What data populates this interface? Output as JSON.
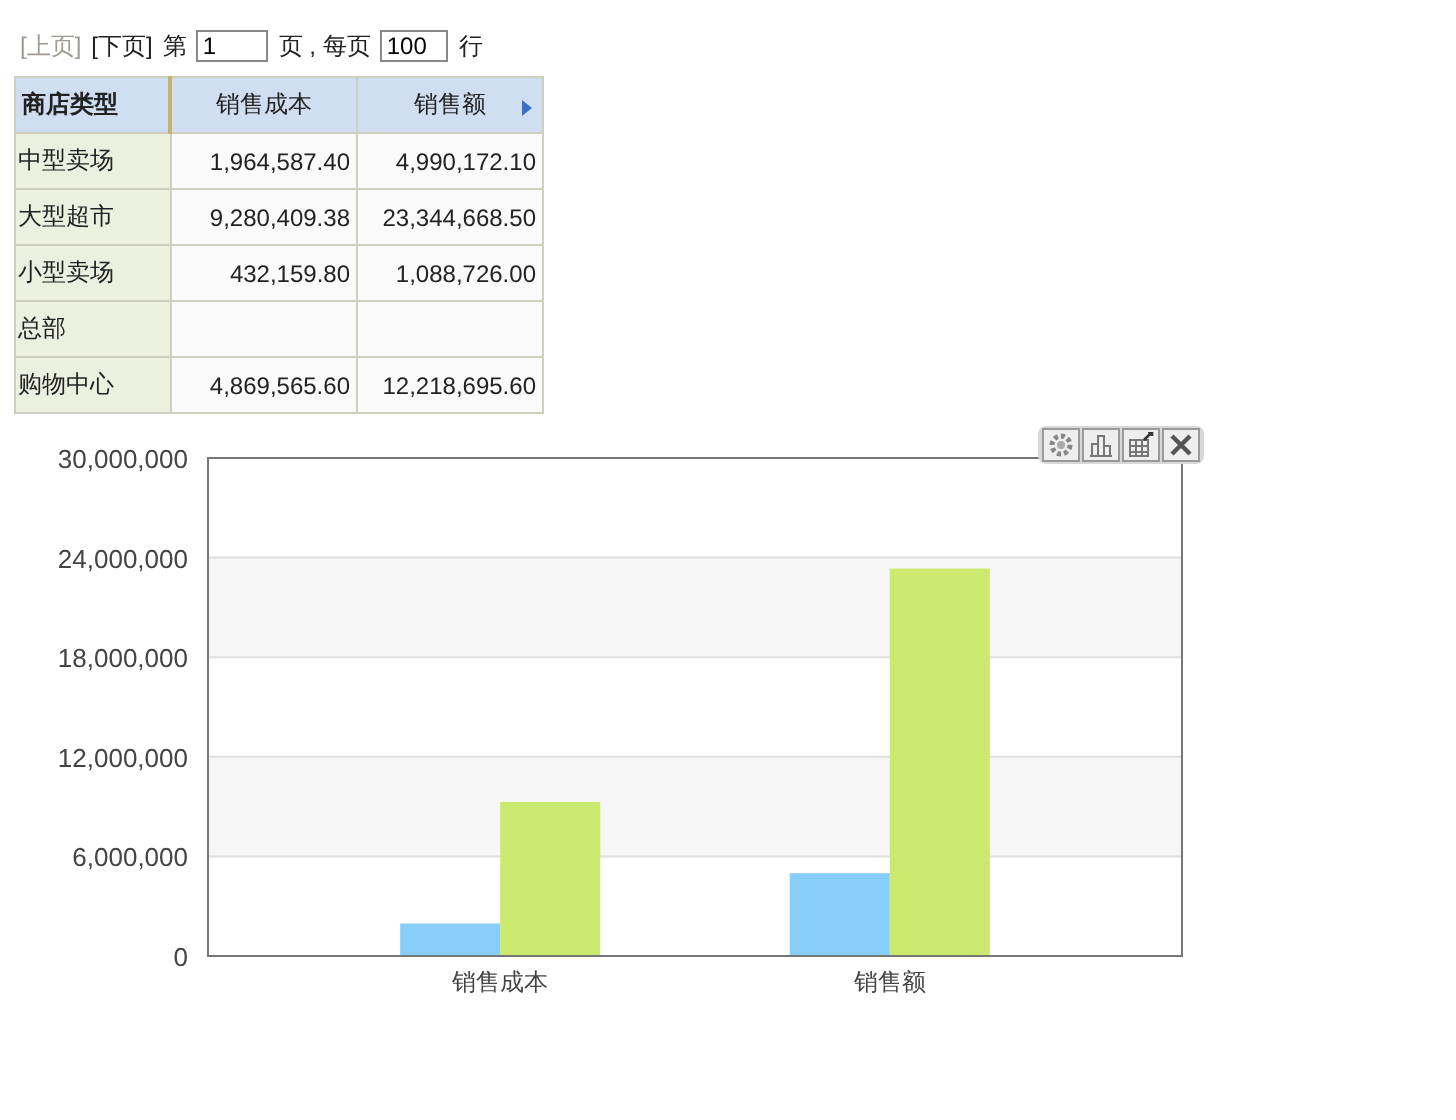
{
  "pager": {
    "prev": {
      "label": "[上页]",
      "disabled": true
    },
    "next": {
      "label": "[下页]",
      "disabled": false
    },
    "page_prefix": "第",
    "page": "1",
    "page_suffix": "页 , 每页",
    "rows_per_page": "100",
    "rows_suffix": "行"
  },
  "table": {
    "columns": [
      {
        "label": "商店类型"
      },
      {
        "label": "销售成本"
      },
      {
        "label": "销售额"
      }
    ],
    "rows": [
      {
        "cells": [
          "中型卖场",
          "1,964,587.40",
          "4,990,172.10"
        ]
      },
      {
        "cells": [
          "大型超市",
          "9,280,409.38",
          "23,344,668.50"
        ]
      },
      {
        "cells": [
          "小型卖场",
          "432,159.80",
          "1,088,726.00"
        ]
      },
      {
        "cells": [
          "总部",
          "",
          ""
        ]
      },
      {
        "cells": [
          "购物中心",
          "4,869,565.60",
          "12,218,695.60"
        ]
      }
    ]
  },
  "chart": {
    "chart_data": {
      "type": "bar",
      "categories": [
        "销售成本",
        "销售额"
      ],
      "series": [
        {
          "color": "#87cefa",
          "values": [
            1960000,
            4990000
          ]
        },
        {
          "color": "#cbe86f",
          "values": [
            9280000,
            23340000
          ]
        }
      ],
      "ylim": [
        0,
        30000000
      ],
      "grid": true,
      "yticks": [
        {
          "value": 0,
          "label": "0"
        },
        {
          "value": 6000000,
          "label": "6,000,000"
        },
        {
          "value": 12000000,
          "label": "12,000,000"
        },
        {
          "value": 18000000,
          "label": "18,000,000"
        },
        {
          "value": 24000000,
          "label": "24,000,000"
        },
        {
          "value": 30000000,
          "label": "30,000,000"
        }
      ]
    }
  }
}
